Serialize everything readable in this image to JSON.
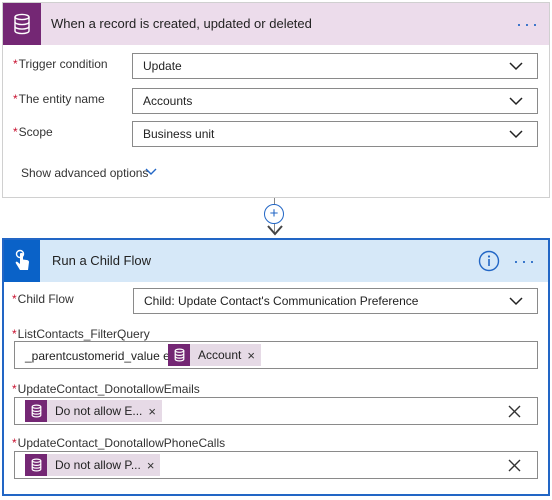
{
  "trigger": {
    "title": "When a record is created, updated or deleted",
    "more": "···",
    "fields": [
      {
        "label": "Trigger condition",
        "value": "Update"
      },
      {
        "label": "The entity name",
        "value": "Accounts"
      },
      {
        "label": "Scope",
        "value": "Business unit"
      }
    ],
    "advanced_label": "Show advanced options",
    "required_mark": "*"
  },
  "connector": {
    "plus": "+"
  },
  "action": {
    "title": "Run a Child Flow",
    "more": "···",
    "child_flow": {
      "label": "Child Flow",
      "value": "Child: Update Contact's Communication Preference"
    },
    "filter_query": {
      "label": "ListContacts_FilterQuery",
      "text": "_parentcustomerid_value eq",
      "token": "Account",
      "token_remove": "×"
    },
    "emails": {
      "label": "UpdateContact_DonotallowEmails",
      "token": "Do not allow E...",
      "token_remove": "×"
    },
    "phone": {
      "label": "UpdateContact_DonotallowPhoneCalls",
      "token": "Do not allow P...",
      "token_remove": "×"
    },
    "required_mark": "*"
  },
  "colors": {
    "dataverse_purple": "#742774",
    "trigger_header": "#ecdceb",
    "action_blue": "#0a62c8",
    "action_header": "#d6e8f8",
    "accent": "#2266c5"
  },
  "icons": [
    "database-icon",
    "chevron-down-icon",
    "plus-icon",
    "arrow-down-icon",
    "touch-hand-icon",
    "info-icon",
    "close-icon"
  ]
}
